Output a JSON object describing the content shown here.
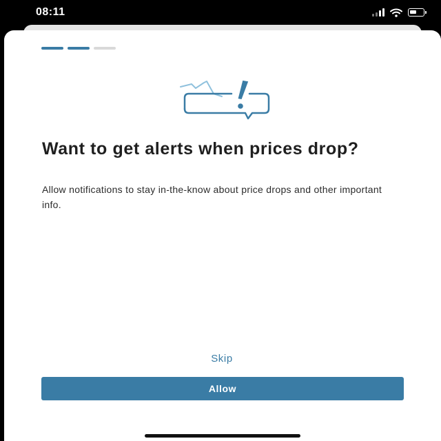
{
  "status_bar": {
    "time": "08:11",
    "icons": [
      "cellular-signal-icon",
      "wifi-icon",
      "battery-icon"
    ]
  },
  "onboarding": {
    "progress": {
      "total_steps": 3,
      "active_steps": 2
    },
    "illustration_icon": "price-alert-chat-bubble-icon",
    "headline": "Want to get alerts when prices drop?",
    "body": "Allow notifications to stay in-the-know about price drops and other important info.",
    "skip_label": "Skip",
    "allow_label": "Allow"
  },
  "colors": {
    "accent": "#3a7ca5",
    "illustration_light": "#8fc1dd",
    "headline": "#1f1f1f",
    "background": "#ffffff"
  }
}
